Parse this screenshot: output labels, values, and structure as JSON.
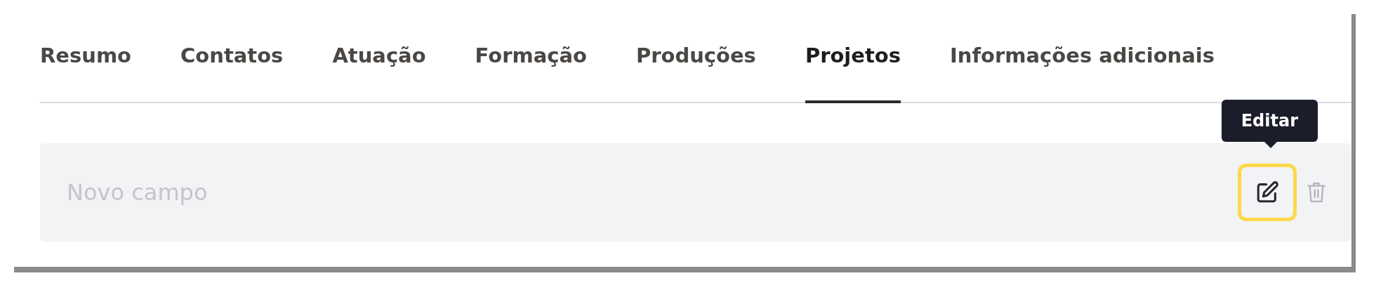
{
  "tabs": [
    {
      "label": "Resumo",
      "selected": false
    },
    {
      "label": "Contatos",
      "selected": false
    },
    {
      "label": "Atuação",
      "selected": false
    },
    {
      "label": "Formação",
      "selected": false
    },
    {
      "label": "Produções",
      "selected": false
    },
    {
      "label": "Projetos",
      "selected": true
    },
    {
      "label": "Informações adicionais",
      "selected": false
    }
  ],
  "field": {
    "placeholder": "Novo campo"
  },
  "tooltip": {
    "text": "Editar"
  }
}
